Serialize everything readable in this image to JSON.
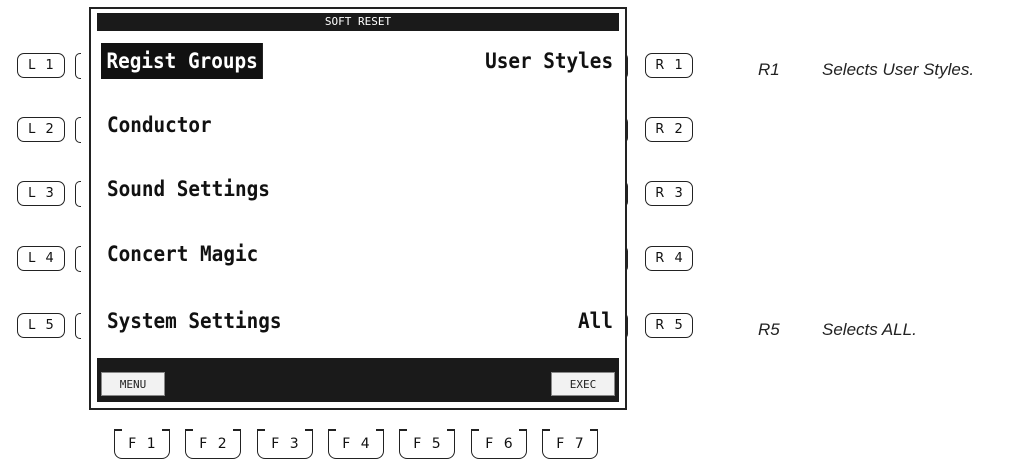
{
  "screen": {
    "title": "SOFT RESET",
    "left_items": [
      {
        "label": "Regist Groups",
        "selected": true
      },
      {
        "label": "Conductor",
        "selected": false
      },
      {
        "label": "Sound Settings",
        "selected": false
      },
      {
        "label": "Concert Magic",
        "selected": false
      },
      {
        "label": "System Settings",
        "selected": false
      }
    ],
    "right_items": [
      {
        "label": "User Styles"
      },
      {
        "label": "All"
      }
    ],
    "footer": {
      "menu_label": "MENU",
      "exec_label": "EXEC"
    }
  },
  "left_buttons": [
    "L1",
    "L2",
    "L3",
    "L4",
    "L5"
  ],
  "right_buttons": [
    "R1",
    "R2",
    "R3",
    "R4",
    "R5"
  ],
  "function_buttons": [
    "F1",
    "F2",
    "F3",
    "F4",
    "F5",
    "F6",
    "F7"
  ],
  "annotations": [
    {
      "key": "R1",
      "text": "Selects User Styles."
    },
    {
      "key": "R5",
      "text": "Selects ALL."
    }
  ]
}
